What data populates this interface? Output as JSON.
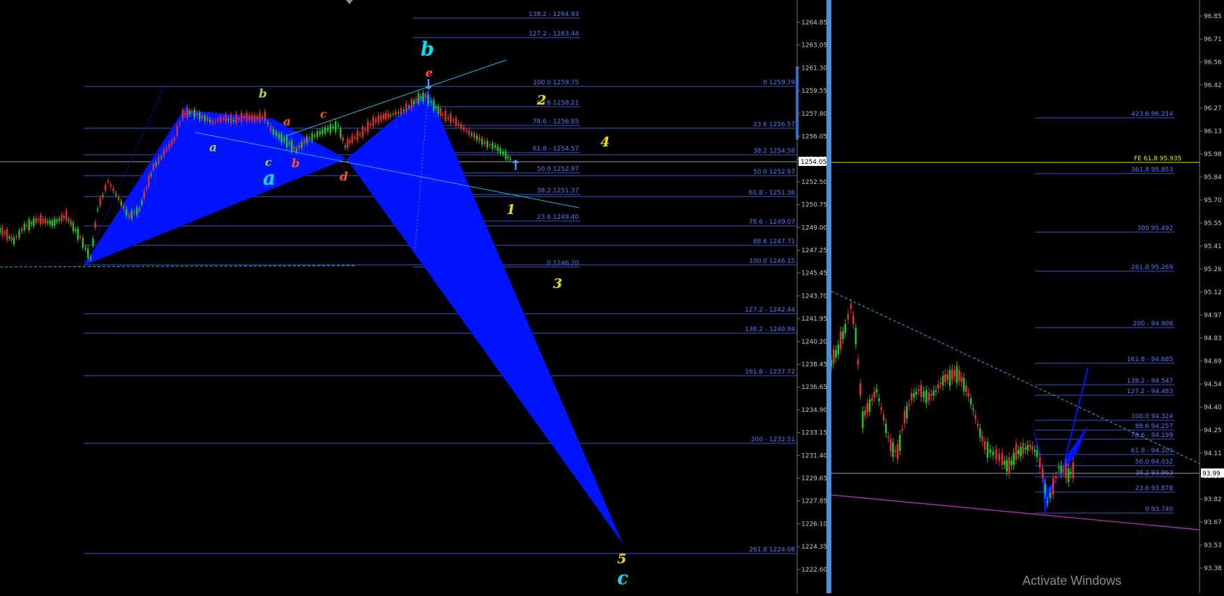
{
  "left_chart": {
    "y_axis_ticks": [
      "1264.85",
      "1263.05",
      "1261.30",
      "1259.55",
      "1257.80",
      "1256.05",
      "1254.30",
      "1252.50",
      "1250.75",
      "1249.00",
      "1247.25",
      "1245.45",
      "1243.70",
      "1241.95",
      "1240.20",
      "1238.45",
      "1236.65",
      "1234.90",
      "1233.15",
      "1231.40",
      "1229.65",
      "1227.85",
      "1226.10",
      "1224.35",
      "1222.60"
    ],
    "price_tag": "1254.05",
    "fib_levels_upper": [
      "138.2 - 1264.93",
      "127.2 - 1263.44",
      "100.0 1259.75",
      "88.6 1258.21",
      "78.6 - 1256.85",
      "61.8 - 1254.57",
      "50.0 1252.97",
      "38.2 1251.37",
      "23.6 1249.40",
      "0 1246.20"
    ],
    "fib_levels_right": [
      "0 1259.79",
      "23.6 1256.57",
      "38.2 1254.58",
      "50.0 1252.97",
      "61.8 - 1251.36",
      "78.6 - 1249.07",
      "88.6 1247.71",
      "100.0 1246.15",
      "127.2 - 1242.44",
      "138.2 - 1240.94",
      "161.8 - 1237.72",
      "200 - 1232.51",
      "261.8 1224.08"
    ],
    "wave_labels": {
      "minor_a": "a",
      "minor_b": "b",
      "minor_c": "c",
      "sub_a": "a",
      "sub_b": "b",
      "sub_c": "c",
      "sub_d": "d",
      "sub_e": "e",
      "major_a": "a",
      "major_b": "b",
      "major_c": "c",
      "n1": "1",
      "n2": "2",
      "n3": "3",
      "n4": "4",
      "n5": "5"
    }
  },
  "right_chart": {
    "y_axis_ticks": [
      "96.85",
      "96.71",
      "96.56",
      "96.42",
      "96.27",
      "96.13",
      "95.98",
      "95.84",
      "95.70",
      "95.55",
      "95.41",
      "95.26",
      "95.12",
      "94.97",
      "94.83",
      "94.69",
      "94.54",
      "94.40",
      "94.25",
      "94.11",
      "93.96",
      "93.82",
      "93.67",
      "93.53",
      "93.38"
    ],
    "price_tag": "93.99",
    "fe_label": "FE 61.8 95.935",
    "fib_levels": [
      "423.6 96.214",
      "361.8 95.853",
      "300 95.492",
      "261.8 95.269",
      "200 - 94.908",
      "161.8 - 94.685",
      "138.2 - 94.547",
      "127.2 - 94.483",
      "100.0 94.324",
      "88.6 94.257",
      "78.6 - 94.199",
      "61.8 - 94.101",
      "50.0 94.032",
      "38.2 93.963",
      "23.6 93.878",
      "0 93.740"
    ]
  },
  "watermark": "Activate Windows",
  "colors": {
    "background": "#000000",
    "pattern_fill": "#0014ff",
    "fib_line": "#3a55d0",
    "trend_line": "#29b6e8",
    "magenta_line": "#d030d0",
    "fe_line": "#e8e800",
    "bull_candle": "#1ec81e",
    "bear_candle": "#e03030",
    "wave_yellow": "#f0e000",
    "wave_cyan": "#00e0f0",
    "wave_orange": "#ff5020",
    "wave_green": "#b0d040"
  }
}
